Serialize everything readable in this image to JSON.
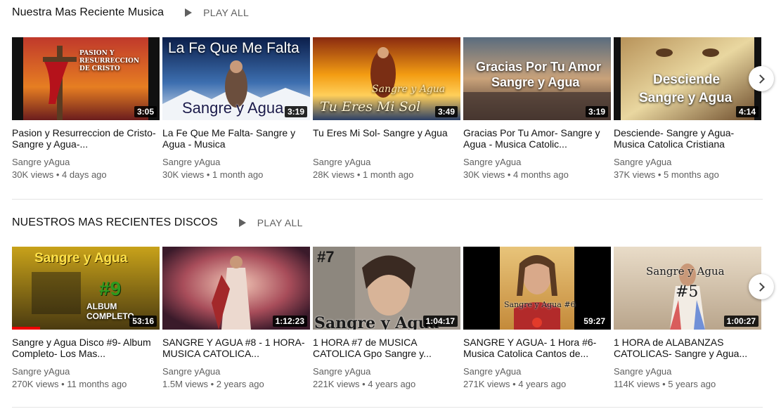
{
  "shelves": [
    {
      "title": "Nuestra Mas Reciente Musica",
      "play_all": "PLAY ALL",
      "videos": [
        {
          "title": "Pasion y Resurreccion de Cristo- Sangre y Agua-...",
          "channel": "Sangre yAgua",
          "meta": "30K views • 4 days ago",
          "duration": "3:05",
          "overlay": "PASION Y RESURRECCION DE CRISTO"
        },
        {
          "title": "La Fe Que Me Falta- Sangre y Agua - Musica",
          "channel": "Sangre yAgua",
          "meta": "30K views • 1 month ago",
          "duration": "3:19",
          "overlay_top": "La Fe Que Me Falta",
          "overlay_bottom": "Sangre y Agua"
        },
        {
          "title": "Tu Eres Mi Sol- Sangre y Agua",
          "channel": "Sangre yAgua",
          "meta": "28K views • 1 month ago",
          "duration": "3:49",
          "overlay_top": "Sangre y Agua",
          "overlay_bottom": "Tu Eres Mi Sol"
        },
        {
          "title": "Gracias Por Tu Amor- Sangre y Agua - Musica Catolic...",
          "channel": "Sangre yAgua",
          "meta": "30K views • 4 months ago",
          "duration": "3:19",
          "overlay_top": "Gracias Por Tu Amor",
          "overlay_bottom": "Sangre y Agua"
        },
        {
          "title": "Desciende- Sangre y Agua- Musica Catolica Cristiana",
          "channel": "Sangre yAgua",
          "meta": "37K views • 5 months ago",
          "duration": "4:14",
          "overlay_top": "Desciende",
          "overlay_bottom": "Sangre y Agua"
        }
      ]
    },
    {
      "title": "NUESTROS MAS RECIENTES DISCOS",
      "play_all": "PLAY ALL",
      "videos": [
        {
          "title": "Sangre y Agua Disco #9- Album Completo- Los Mas...",
          "channel": "Sangre yAgua",
          "meta": "270K views • 11 months ago",
          "duration": "53:16",
          "overlay_top": "Sangre y Agua",
          "overlay_mid": "#9",
          "overlay_bottom": "ALBUM COMPLETO",
          "watch_progress": 0.19
        },
        {
          "title": "SANGRE Y AGUA #8 - 1 HORA- MUSICA CATOLICA...",
          "channel": "Sangre yAgua",
          "meta": "1.5M views • 2 years ago",
          "duration": "1:12:23"
        },
        {
          "title": "1 HORA #7 de MUSICA CATOLICA Gpo Sangre y...",
          "channel": "Sangre yAgua",
          "meta": "221K views • 4 years ago",
          "duration": "1:04:17",
          "overlay_top": "#7",
          "overlay_bottom": "Sangre y Agua"
        },
        {
          "title": "SANGRE Y AGUA- 1 Hora #6- Musica Catolica Cantos de...",
          "channel": "Sangre yAgua",
          "meta": "271K views • 4 years ago",
          "duration": "59:27",
          "overlay_bottom": "Sangre y Agua #6"
        },
        {
          "title": "1 HORA de ALABANZAS CATOLICAS- Sangre y Agua...",
          "channel": "Sangre yAgua",
          "meta": "114K views • 5 years ago",
          "duration": "1:00:27",
          "overlay_top": "Sangre y Agua",
          "overlay_mid": "#5"
        }
      ]
    }
  ],
  "icons": {
    "play_all": "play-triangle-icon",
    "next": "chevron-right-icon"
  },
  "colors": {
    "progress": "#ee0000",
    "secondary_text": "#606060"
  }
}
